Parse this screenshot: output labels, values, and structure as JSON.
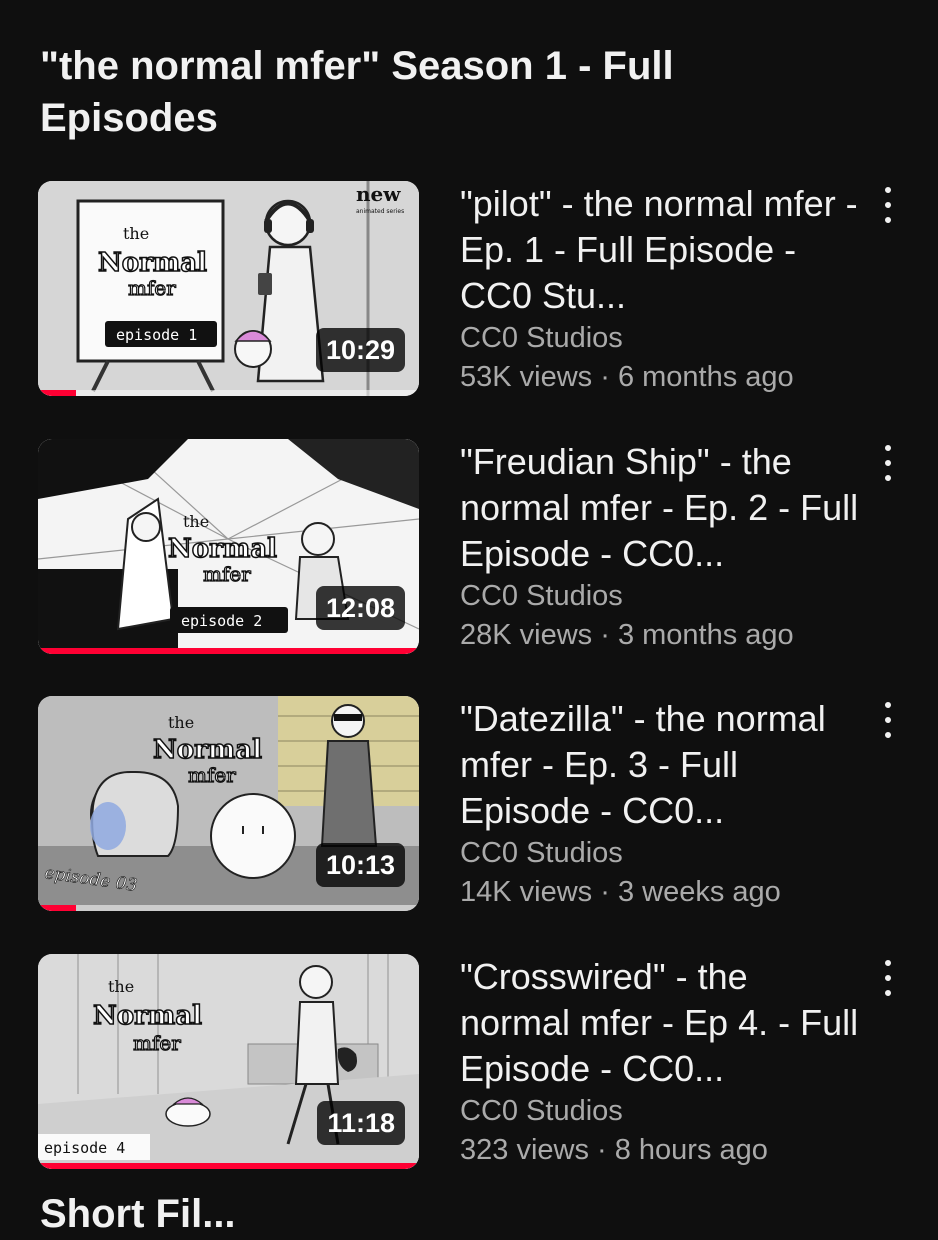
{
  "playlist": {
    "title": "\"the normal mfer\" Season 1 - Full Episodes"
  },
  "videos": [
    {
      "title": "\"pilot\" - the normal mfer - Ep. 1 - Full Episode - CC0 Stu...",
      "channel": "CC0 Studios",
      "stats": "53K views · 6 months ago",
      "duration": "10:29",
      "watched_fraction": 0.1,
      "thumb_logo_lines": [
        "the",
        "Normal",
        "mfer"
      ],
      "thumb_episode_label": "episode 1",
      "thumb_corner_label": "new",
      "thumb_corner_sublabel": "animated series"
    },
    {
      "title": "\"Freudian Ship\" - the normal mfer - Ep. 2 - Full Episode - CC0...",
      "channel": "CC0 Studios",
      "stats": "28K views · 3 months ago",
      "duration": "12:08",
      "watched_fraction": 1.0,
      "thumb_logo_lines": [
        "the",
        "Normal",
        "mfer"
      ],
      "thumb_episode_label": "episode 2"
    },
    {
      "title": "\"Datezilla\" - the normal mfer - Ep. 3 - Full Episode - CC0...",
      "channel": "CC0 Studios",
      "stats": "14K views · 3 weeks ago",
      "duration": "10:13",
      "watched_fraction": 0.1,
      "thumb_logo_lines": [
        "the",
        "Normal",
        "mfer"
      ],
      "thumb_episode_label": "episode 03"
    },
    {
      "title": "\"Crosswired\" - the normal mfer - Ep 4. - Full Episode - CC0...",
      "channel": "CC0 Studios",
      "stats": "323 views · 8 hours ago",
      "duration": "11:18",
      "watched_fraction": 1.0,
      "thumb_logo_lines": [
        "the",
        "Normal",
        "mfer"
      ],
      "thumb_episode_label": "episode 4"
    }
  ],
  "next_section": {
    "title": "Short Fil..."
  },
  "colors": {
    "background": "#0f0f0f",
    "progress": "#ff0033",
    "secondary_text": "#aaaaaa"
  }
}
